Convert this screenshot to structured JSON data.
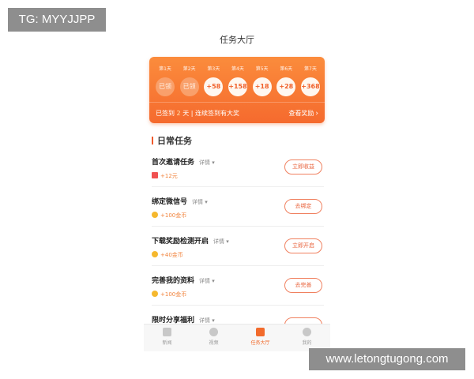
{
  "watermark_top": "TG: MYYJJPP",
  "watermark_bottom": "www.letongtugong.com",
  "page_title": "任务大厅",
  "signin": {
    "days": [
      "第1天",
      "第2天",
      "第3天",
      "第4天",
      "第5天",
      "第6天",
      "第7天"
    ],
    "rewards": [
      "已领",
      "已领",
      "+58",
      "+158",
      "+18",
      "+28",
      "+368"
    ],
    "status_prefix": "已签到",
    "status_days": "2",
    "status_suffix": "天 | 连续签到有大奖",
    "view_rewards": "查看奖励"
  },
  "section_title": "日常任务",
  "tasks": [
    {
      "name": "首次邀请任务",
      "detail": "详情",
      "reward": "+12元",
      "button": "立即收益"
    },
    {
      "name": "绑定微信号",
      "detail": "详情",
      "reward": "+100金币",
      "button": "去绑定"
    },
    {
      "name": "下载奖励检测开启",
      "detail": "详情",
      "reward": "+40金币",
      "button": "立即开启"
    },
    {
      "name": "完善我的资料",
      "detail": "详情",
      "reward": "+100金币",
      "button": "去完善"
    },
    {
      "name": "限时分享福利",
      "detail": "详情",
      "reward": "",
      "button": ""
    }
  ],
  "tabs": [
    {
      "label": "新闻",
      "icon": "news-icon"
    },
    {
      "label": "视频",
      "icon": "video-icon"
    },
    {
      "label": "任务大厅",
      "icon": "task-icon"
    },
    {
      "label": "我的",
      "icon": "profile-icon"
    }
  ],
  "colors": {
    "accent": "#f26b2c",
    "card_top": "#fb8c3c",
    "card_bottom": "#f56a2e",
    "coin": "#f5b82e"
  }
}
